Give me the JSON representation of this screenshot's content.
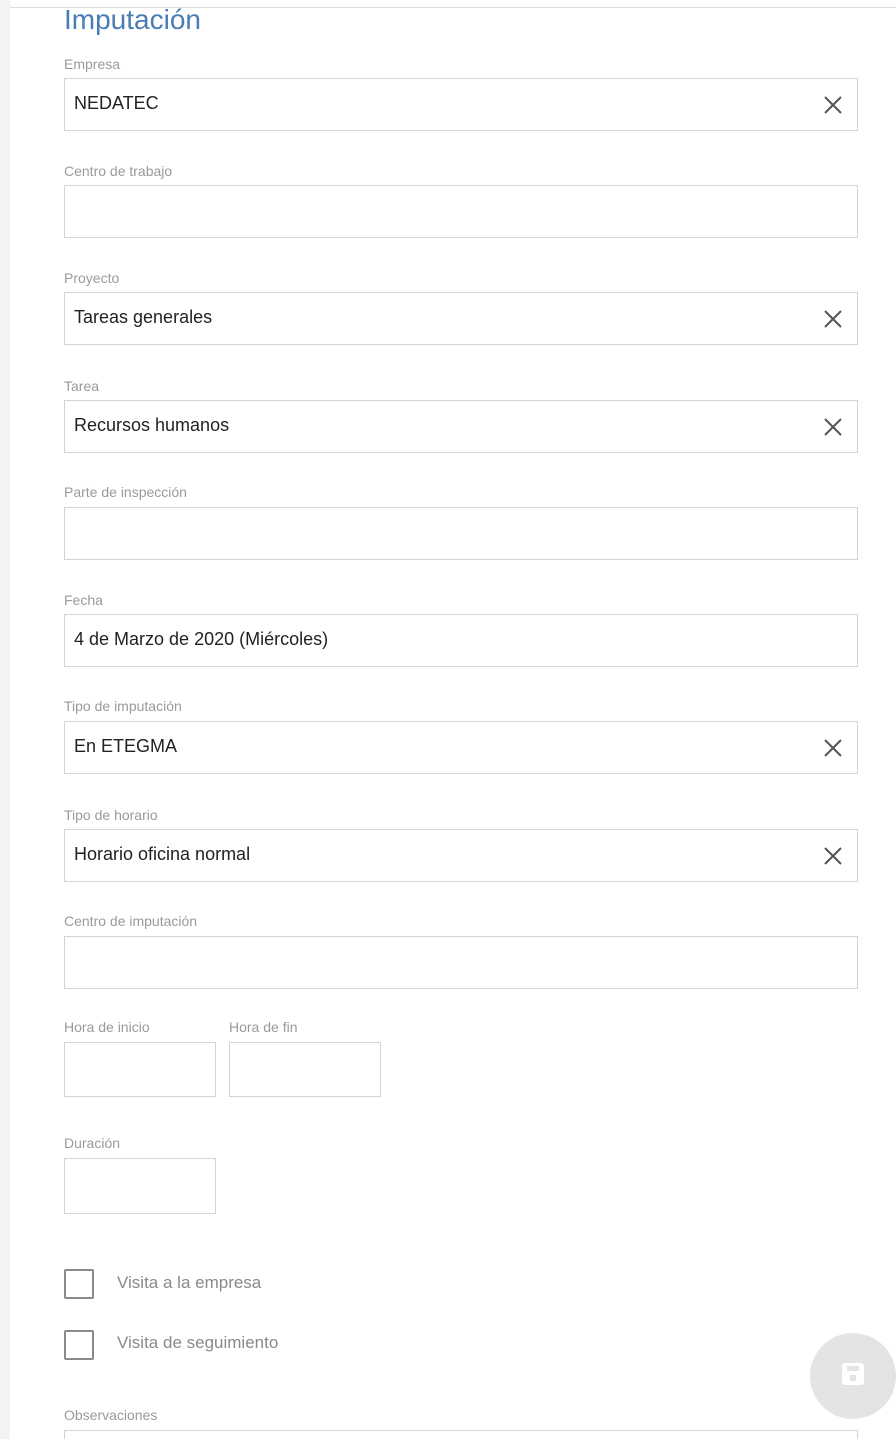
{
  "form": {
    "title": "Imputación",
    "empresa": {
      "label": "Empresa",
      "value": "NEDATEC"
    },
    "centro_trabajo": {
      "label": "Centro de trabajo",
      "value": ""
    },
    "proyecto": {
      "label": "Proyecto",
      "value": "Tareas generales"
    },
    "tarea": {
      "label": "Tarea",
      "value": "Recursos humanos"
    },
    "parte_inspeccion": {
      "label": "Parte de inspección",
      "value": ""
    },
    "fecha": {
      "label": "Fecha",
      "value": "4 de Marzo de 2020 (Miércoles)"
    },
    "tipo_imputacion": {
      "label": "Tipo de imputación",
      "value": "En ETEGMA"
    },
    "tipo_horario": {
      "label": "Tipo de horario",
      "value": "Horario oficina normal"
    },
    "centro_imputacion": {
      "label": "Centro de imputación",
      "value": ""
    },
    "hora_inicio": {
      "label": "Hora de inicio",
      "value": ""
    },
    "hora_fin": {
      "label": "Hora de fin",
      "value": ""
    },
    "duracion": {
      "label": "Duración",
      "value": ""
    },
    "visita_empresa": {
      "label": "Visita a la empresa",
      "checked": false
    },
    "visita_seguimiento": {
      "label": "Visita de seguimiento",
      "checked": false
    },
    "observaciones": {
      "label": "Observaciones",
      "value": ""
    }
  },
  "icons": {
    "clear": "close-icon",
    "save": "save-icon"
  },
  "colors": {
    "title": "#4a7cb5",
    "label": "#9a9a9a",
    "border": "#d4d4d4",
    "fab": "#e4e4e4"
  }
}
